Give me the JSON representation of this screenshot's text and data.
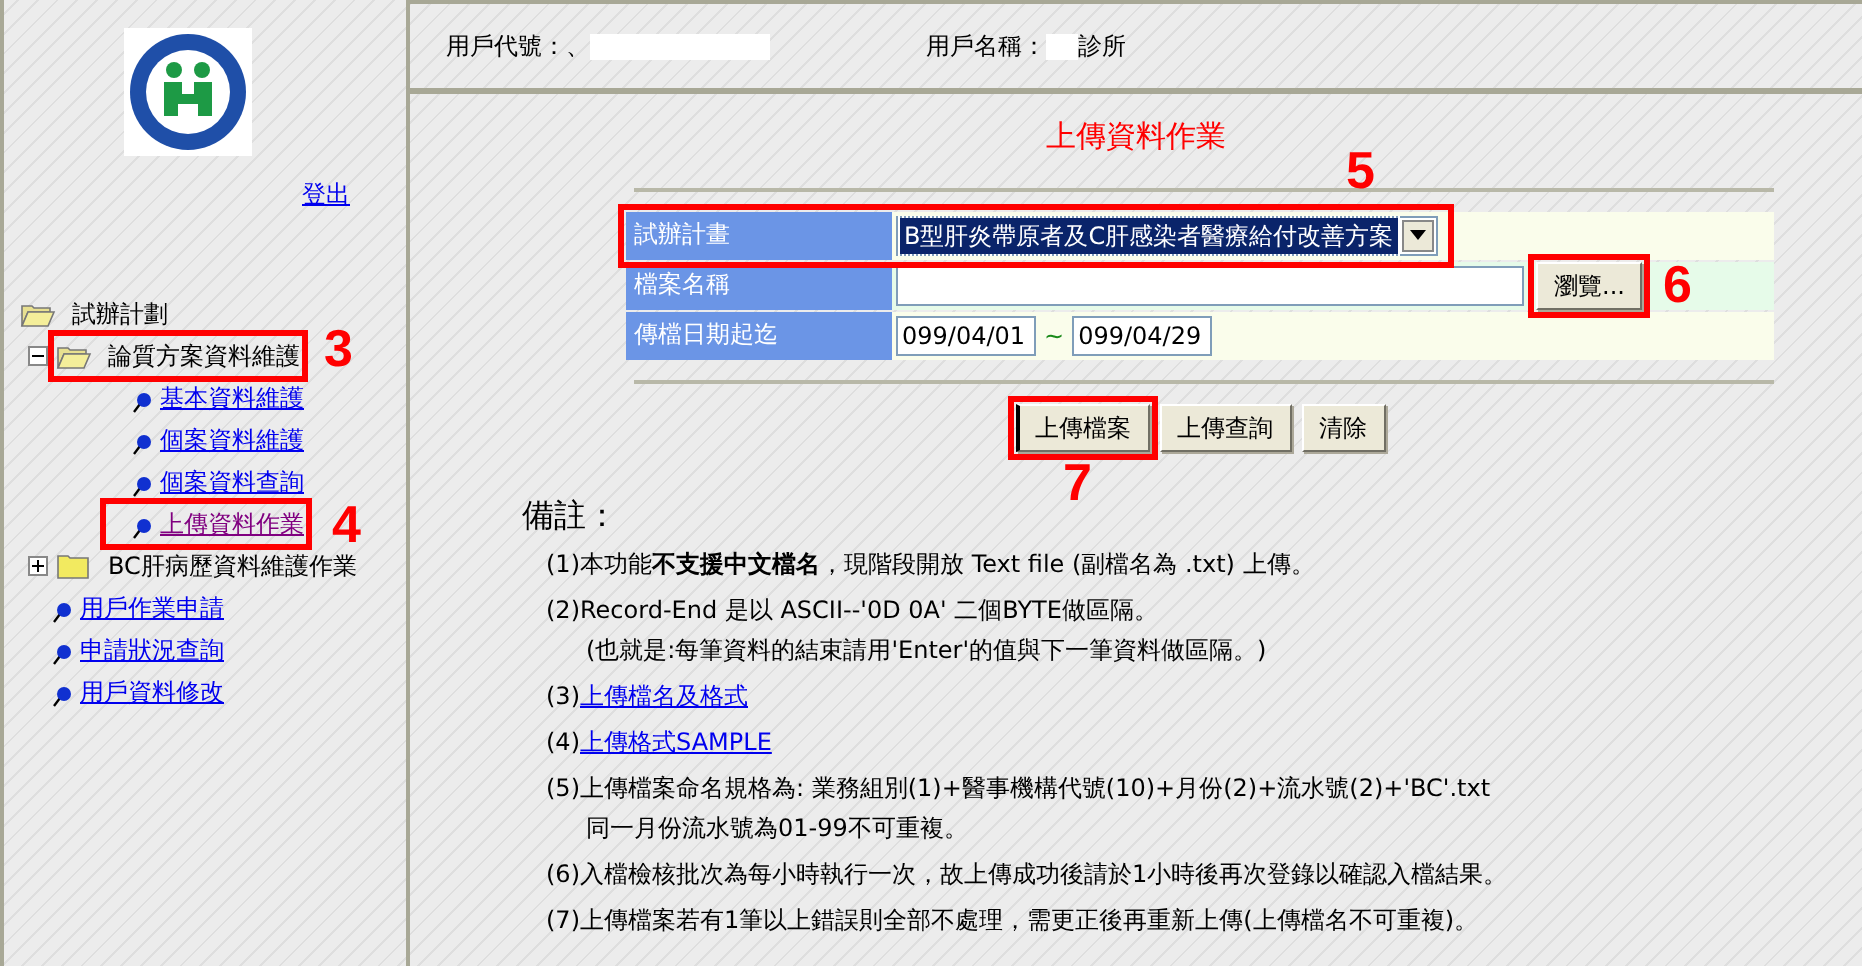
{
  "sidebar": {
    "logout_link": "登出",
    "tree": [
      {
        "label": "試辦計劃",
        "kind": "folder",
        "expanded": true,
        "children": [
          {
            "label": "論質方案資料維護",
            "kind": "folder",
            "expanded": true,
            "callout": "3",
            "children": [
              {
                "label": "基本資料維護",
                "kind": "link",
                "visited": false
              },
              {
                "label": "個案資料維護",
                "kind": "link",
                "visited": false
              },
              {
                "label": "個案資料查詢",
                "kind": "link",
                "visited": false
              },
              {
                "label": "上傳資料作業",
                "kind": "link",
                "visited": true,
                "callout": "4"
              }
            ]
          },
          {
            "label": "BC肝病歷資料維護作業",
            "kind": "folder",
            "expanded": false
          },
          {
            "label": "用戶作業申請",
            "kind": "link",
            "visited": false
          },
          {
            "label": "申請狀況查詢",
            "kind": "link",
            "visited": false
          },
          {
            "label": "用戶資料修改",
            "kind": "link",
            "visited": false
          }
        ]
      }
    ]
  },
  "header": {
    "user_id_label": "用戶代號：",
    "user_id_value": "、",
    "user_name_label": "用戶名稱：",
    "user_name_value": "診所"
  },
  "page_title": "上傳資料作業",
  "form": {
    "plan": {
      "label": "試辦計畫",
      "value": "B型肝炎帶原者及C肝感染者醫療給付改善方案",
      "callout": "5"
    },
    "file": {
      "label": "檔案名稱",
      "browse_button": "瀏覽...",
      "callout": "6"
    },
    "dates": {
      "label": "傳檔日期起迄",
      "from": "099/04/01",
      "separator": "~",
      "to": "099/04/29"
    }
  },
  "buttons": [
    {
      "label": "上傳檔案",
      "focused": true,
      "callout": "7"
    },
    {
      "label": "上傳查詢",
      "focused": false
    },
    {
      "label": "清除",
      "focused": false
    }
  ],
  "notes": {
    "title": "備註：",
    "items": [
      {
        "kind": "text",
        "text": "(1)本功能**不支援中文檔名**，現階段開放 Text file (副檔名為 .txt) 上傳。"
      },
      {
        "kind": "text",
        "text": "(2)Record-End 是以 ASCII--'0D 0A' 二個BYTE做區隔。",
        "continuation": "(也就是:每筆資料的結束請用'Enter'的值與下一筆資料做區隔。)"
      },
      {
        "kind": "link",
        "prefix": "(3)",
        "link": "上傳檔名及格式"
      },
      {
        "kind": "link",
        "prefix": "(4)",
        "link": "上傳格式SAMPLE"
      },
      {
        "kind": "text",
        "text": "(5)上傳檔案命名規格為: 業務組別(1)+醫事機構代號(10)+月份(2)+流水號(2)+'BC'.txt",
        "continuation": "同一月份流水號為01-99不可重複。"
      },
      {
        "kind": "text",
        "text": "(6)入檔檢核批次為每小時執行一次，故上傳成功後請於1小時後再次登錄以確認入檔結果。"
      },
      {
        "kind": "text",
        "text": "(7)上傳檔案若有1筆以上錯誤則全部不處理，需更正後再重新上傳(上傳檔名不可重複)。"
      }
    ]
  }
}
